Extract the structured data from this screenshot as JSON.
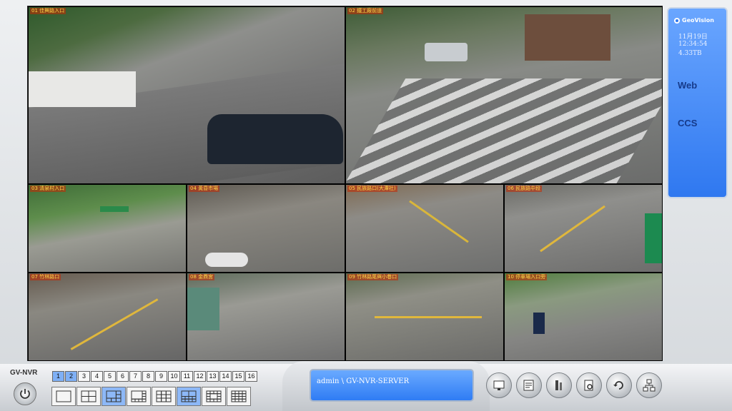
{
  "brand": {
    "name": "GeoVision"
  },
  "status_panel": {
    "date": "11月19日",
    "time": "12:34:54",
    "storage": "4.33TB",
    "web_label": "Web",
    "ccs_label": "CCS"
  },
  "app": {
    "name": "GV-NVR"
  },
  "session": {
    "text": "admin \\ GV-NVR-SERVER"
  },
  "cameras": [
    {
      "label": "01 佳興路入口"
    },
    {
      "label": "02 鐵工廠前道"
    },
    {
      "label": "03 清泉村入口"
    },
    {
      "label": "04 黃昏市場"
    },
    {
      "label": "05 民族路口(大潭社)"
    },
    {
      "label": "06 民族路中段"
    },
    {
      "label": "07 竹林路口"
    },
    {
      "label": "08 金鼎宮"
    },
    {
      "label": "09 竹林路尾與小巷口"
    },
    {
      "label": "10 停車場入口旁"
    }
  ],
  "camera_tabs": [
    "1",
    "2",
    "3",
    "4",
    "5",
    "6",
    "7",
    "8",
    "9",
    "10",
    "11",
    "12",
    "13",
    "14",
    "15",
    "16"
  ],
  "selected_tabs": [
    "1",
    "2"
  ],
  "layouts": [
    {
      "name": "layout-1x1"
    },
    {
      "name": "layout-2x2"
    },
    {
      "name": "layout-1-plus-5",
      "selected": true
    },
    {
      "name": "layout-1-plus-7"
    },
    {
      "name": "layout-3x3"
    },
    {
      "name": "layout-2-plus-8",
      "selected": true
    },
    {
      "name": "layout-1-plus-12"
    },
    {
      "name": "layout-4x4"
    }
  ],
  "tools": [
    {
      "icon": "monitor-icon"
    },
    {
      "icon": "schedule-icon"
    },
    {
      "icon": "tools-icon"
    },
    {
      "icon": "search-icon"
    },
    {
      "icon": "refresh-icon"
    },
    {
      "icon": "network-icon"
    }
  ],
  "colors": {
    "accent": "#2f78f0",
    "panel": "#6aa6ff",
    "label": "#ffd84a"
  }
}
